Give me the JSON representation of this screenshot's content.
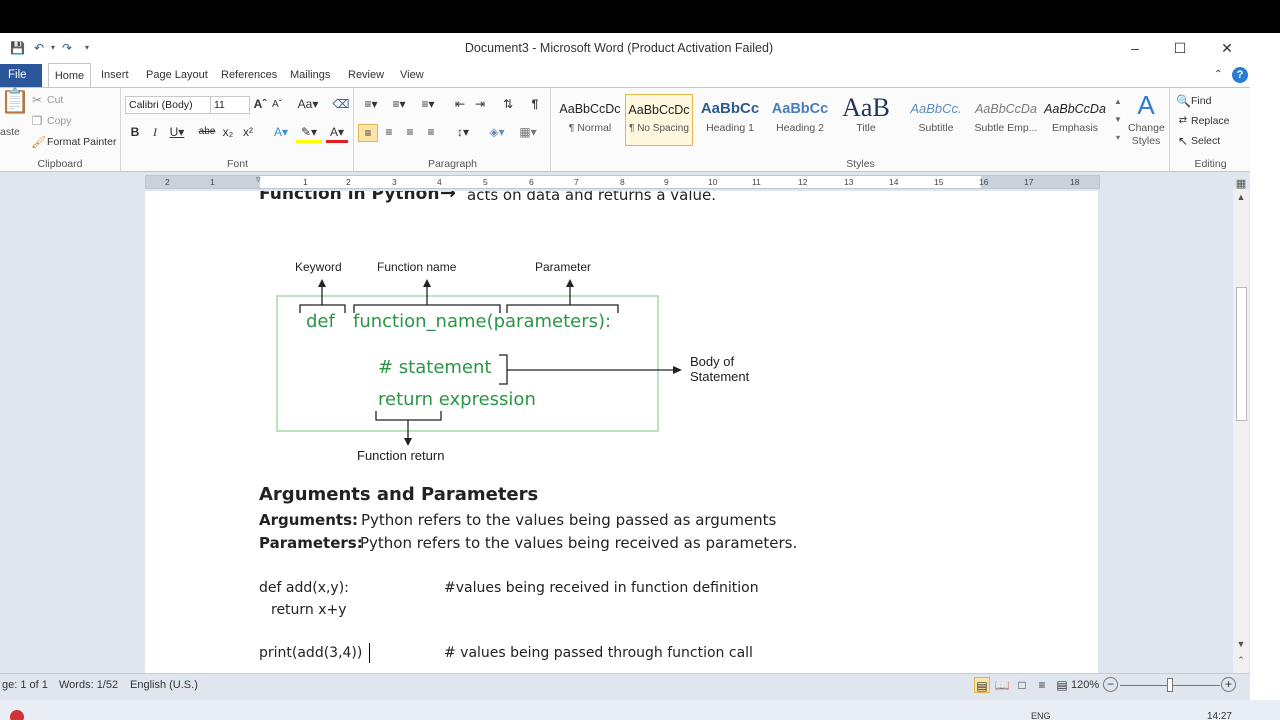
{
  "window": {
    "title": "Document3 - Microsoft Word (Product Activation Failed)",
    "minimize": "–",
    "maximize": "☐",
    "close": "✕"
  },
  "tabs": {
    "file": "File",
    "items": [
      "Home",
      "Insert",
      "Page Layout",
      "References",
      "Mailings",
      "Review",
      "View"
    ]
  },
  "ribbon": {
    "clipboard": {
      "label": "Clipboard",
      "paste": "aste",
      "cut": "Cut",
      "copy": "Copy",
      "format_painter": "Format Painter"
    },
    "font": {
      "label": "Font",
      "family": "Calibri (Body)",
      "size": "11"
    },
    "paragraph": {
      "label": "Paragraph"
    },
    "styles": {
      "label": "Styles",
      "items": [
        {
          "sample": "AaBbCcDc",
          "name": "¶ Normal"
        },
        {
          "sample": "AaBbCcDc",
          "name": "¶ No Spacing"
        },
        {
          "sample": "AaBbCc",
          "name": "Heading 1"
        },
        {
          "sample": "AaBbCc",
          "name": "Heading 2"
        },
        {
          "sample": "AaB",
          "name": "Title"
        },
        {
          "sample": "AaBbCc.",
          "name": "Subtitle"
        },
        {
          "sample": "AaBbCcDa",
          "name": "Subtle Emp..."
        },
        {
          "sample": "AaBbCcDa",
          "name": "Emphasis"
        }
      ],
      "change_styles_1": "Change",
      "change_styles_2": "Styles"
    },
    "editing": {
      "label": "Editing",
      "find": "Find",
      "replace": "Replace",
      "select": "Select"
    }
  },
  "ruler": [
    "2",
    "1",
    "1",
    "1",
    "2",
    "3",
    "4",
    "5",
    "6",
    "7",
    "8",
    "9",
    "10",
    "11",
    "12",
    "13",
    "14",
    "15",
    "16",
    "17",
    "18"
  ],
  "document": {
    "heading_bold": "Function in Python",
    "heading_arrow": "→",
    "heading_rest": "acts on data and returns a value.",
    "diagram": {
      "keyword": "Keyword",
      "function_name": "Function name",
      "parameter": "Parameter",
      "def": "def",
      "signature": "function_name(parameters):",
      "statement": "# statement",
      "return_expr": "return expression",
      "body_1": "Body of",
      "body_2": "Statement",
      "function_return": "Function return"
    },
    "section_heading": "Arguments and Parameters",
    "arguments_label": "Arguments:",
    "arguments_text": "Python refers to the values being passed as arguments",
    "parameters_label": "Parameters:",
    "parameters_text": "Python refers to the values being received as parameters.",
    "code_line1": "def add(x,y):",
    "code_comment1": "#values being received in function definition",
    "code_line2": "return x+y",
    "code_line3": "print(add(3,4))",
    "code_comment3": "# values being passed through function call"
  },
  "status": {
    "page": "ge: 1 of 1",
    "words": "Words: 1/52",
    "language": "English (U.S.)",
    "zoom": "120%"
  },
  "taskbar": {
    "lang": "ENG",
    "time": "14:27"
  }
}
